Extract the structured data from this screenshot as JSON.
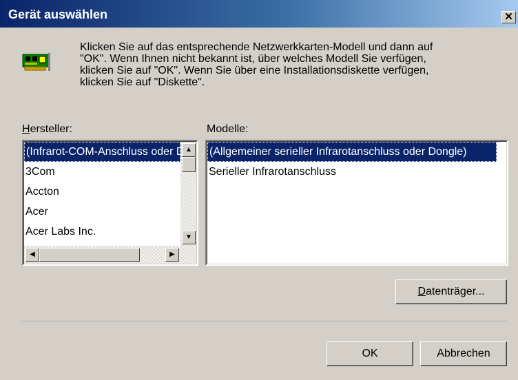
{
  "window": {
    "title": "Gerät auswählen",
    "close_glyph": "✕"
  },
  "instructions": {
    "line1": "Klicken Sie auf das entsprechende Netzwerkkarten-Modell und dann auf",
    "line2": "\"OK\". Wenn Ihnen nicht bekannt ist, über welches Modell Sie verfügen,",
    "line3": "klicken Sie auf \"OK\".  Wenn Sie über eine Installationsdiskette verfügen,",
    "line4": "klicken Sie auf \"Diskette\"."
  },
  "icon": "network-card-icon",
  "manufacturers": {
    "label_first": "H",
    "label_rest": "ersteller:",
    "items": [
      "(Infrarot-COM-Anschluss oder Dongle)",
      "3Com",
      "Accton",
      "Acer",
      "Acer Labs Inc."
    ],
    "selected_index": 0
  },
  "models": {
    "label": "Modelle:",
    "items": [
      "(Allgemeiner serieller Infrarotanschluss oder Dongle)",
      "Serieller Infrarotanschluss"
    ],
    "selected_index": 0
  },
  "buttons": {
    "disk_first": "D",
    "disk_rest": "atenträger...",
    "ok": "OK",
    "cancel": "Abbrechen"
  },
  "colors": {
    "title_start": "#0a246a",
    "title_end": "#a6caf0",
    "selection": "#0a246a",
    "face": "#d4d0c8"
  }
}
